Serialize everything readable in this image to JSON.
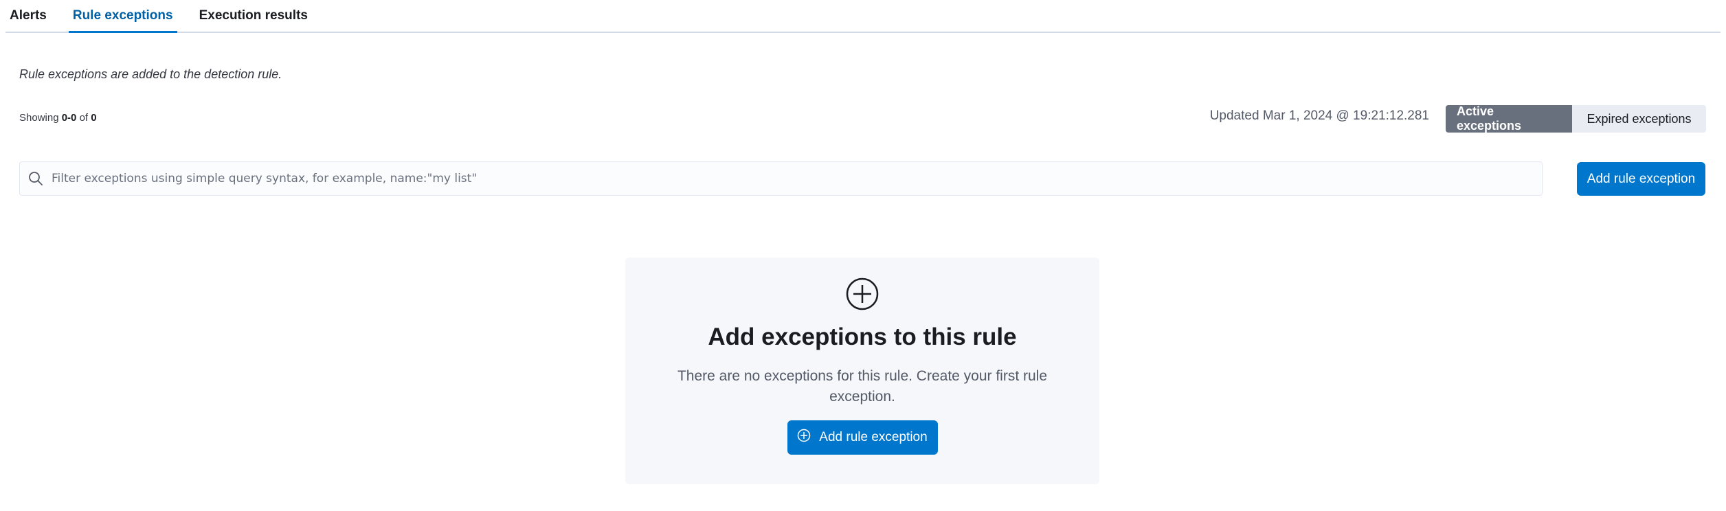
{
  "tabs": [
    {
      "label": "Alerts",
      "active": false
    },
    {
      "label": "Rule exceptions",
      "active": true
    },
    {
      "label": "Execution results",
      "active": false
    }
  ],
  "description": "Rule exceptions are added to the detection rule.",
  "showing": {
    "prefix": "Showing",
    "range": "0-0",
    "of": "of",
    "total": "0"
  },
  "updated": "Updated Mar 1, 2024 @ 19:21:12.281",
  "toggle": {
    "active_label": "Active exceptions",
    "expired_label": "Expired exceptions"
  },
  "search": {
    "placeholder": "Filter exceptions using simple query syntax, for example, name:\"my list\"",
    "value": "",
    "icon": "search-icon"
  },
  "add_button_label": "Add rule exception",
  "empty_state": {
    "icon": "plus-in-circle-icon",
    "title": "Add exceptions to this rule",
    "body": "There are no exceptions for this rule. Create your first rule exception.",
    "button_label": "Add rule exception",
    "button_icon": "plus-in-circle-icon"
  },
  "colors": {
    "primary": "#0077cc",
    "active_tab": "#0061a6",
    "toggle_active": "#69707d",
    "panel": "#f5f7fa"
  }
}
